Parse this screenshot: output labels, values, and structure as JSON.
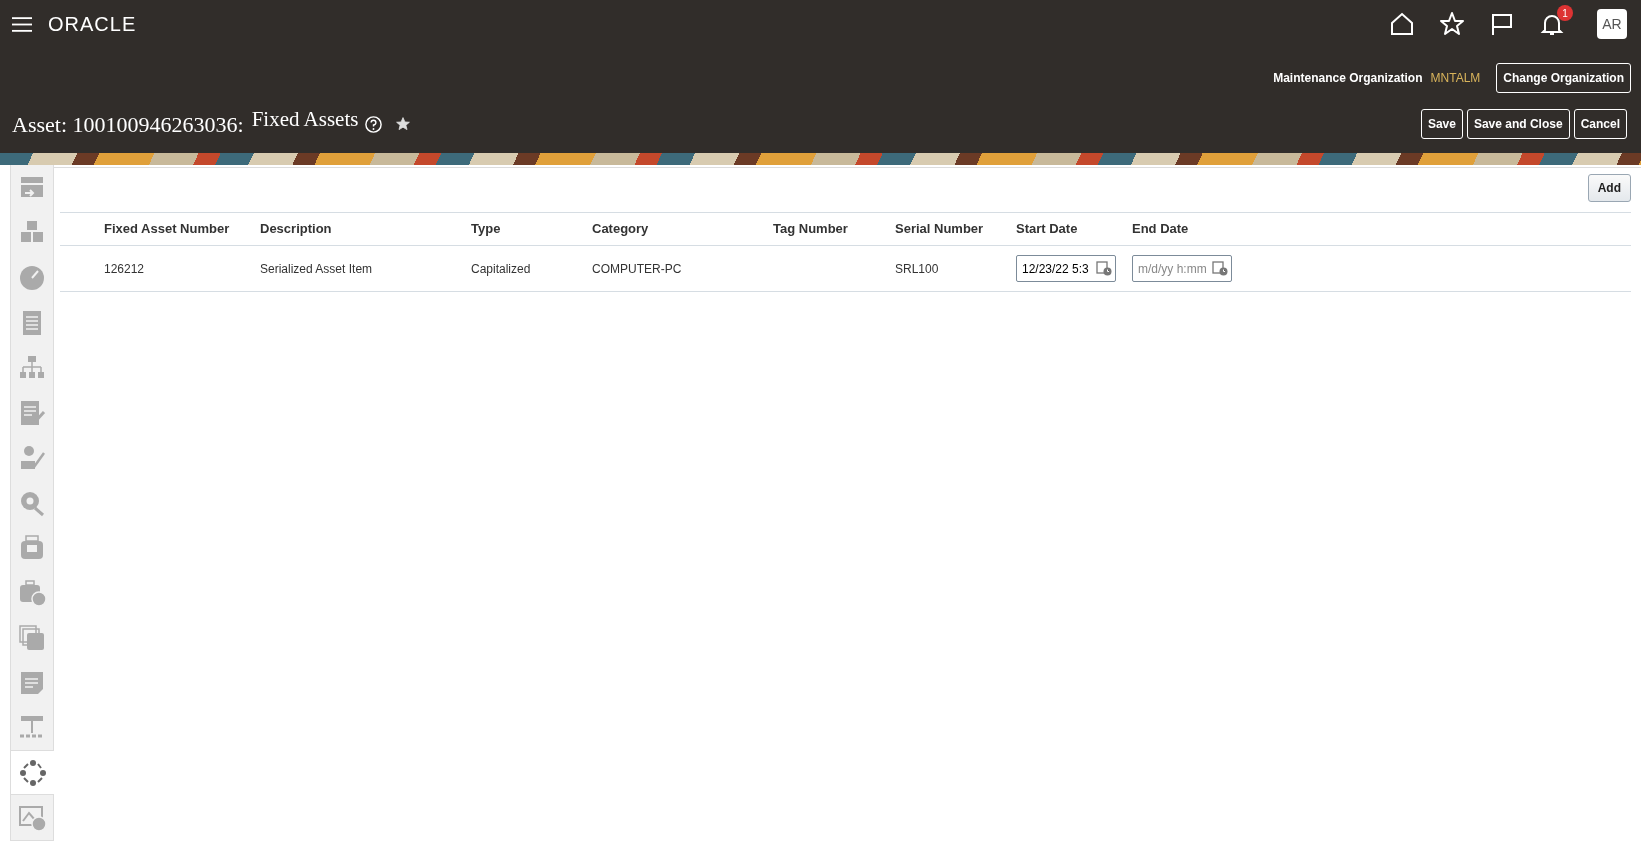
{
  "header": {
    "logo": "ORACLE",
    "notifications": {
      "count": "1"
    },
    "user_initials": "AR"
  },
  "organization": {
    "label": "Maintenance Organization",
    "value": "MNTALM",
    "button": "Change Organization"
  },
  "page": {
    "title": "Asset: 100100946263036:",
    "subtitle": "Fixed Assets",
    "favorite": true
  },
  "actions": [
    "Save",
    "Save and Close",
    "Cancel"
  ],
  "sidebar": {
    "items": [
      {
        "selected": false
      },
      {
        "selected": false
      },
      {
        "selected": false
      },
      {
        "selected": false
      },
      {
        "selected": false
      },
      {
        "selected": false
      },
      {
        "selected": false
      },
      {
        "selected": false
      },
      {
        "selected": false
      },
      {
        "selected": false
      },
      {
        "selected": false
      },
      {
        "selected": false
      },
      {
        "selected": false
      },
      {
        "selected": true
      },
      {
        "selected": false
      }
    ]
  },
  "toolbar": {
    "button": "Add"
  },
  "table": {
    "columns": [
      "Fixed Asset Number",
      "Description",
      "Type",
      "Category",
      "Tag Number",
      "Serial Number",
      "Start Date",
      "End Date"
    ],
    "rows": [
      {
        "cells": [
          "126212",
          "Serialized Asset Item",
          "Capitalized",
          "COMPUTER-PC",
          "",
          "SRL100"
        ],
        "start_date": {
          "value": "12/23/22 5:3"
        },
        "end_date": {
          "placeholder": "m/d/yy h:mm"
        }
      }
    ]
  }
}
